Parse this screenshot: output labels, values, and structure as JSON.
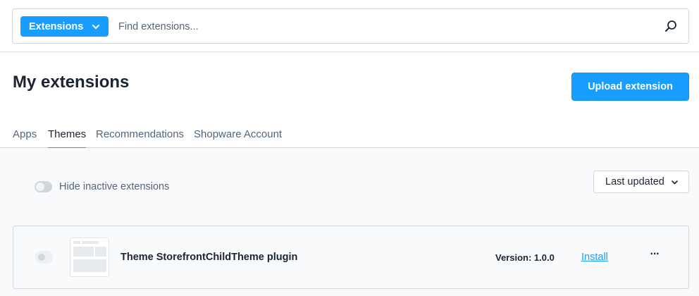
{
  "search": {
    "type_select_label": "Extensions",
    "placeholder": "Find extensions..."
  },
  "header": {
    "title": "My extensions",
    "upload_label": "Upload extension"
  },
  "tabs": [
    {
      "label": "Apps",
      "active": false
    },
    {
      "label": "Themes",
      "active": true
    },
    {
      "label": "Recommendations",
      "active": false
    },
    {
      "label": "Shopware Account",
      "active": false
    }
  ],
  "filters": {
    "hide_inactive_label": "Hide inactive extensions",
    "hide_inactive_on": false,
    "sort_label": "Last updated"
  },
  "extensions": [
    {
      "name": "Theme StorefrontChildTheme plugin",
      "version": "Version: 1.0.0",
      "action_label": "Install",
      "more_label": "···",
      "active": false
    }
  ],
  "colors": {
    "primary": "#189eff",
    "text": "#1a2533",
    "muted": "#52667a",
    "border": "#d1d6dc",
    "content_bg": "#f9fafb"
  }
}
